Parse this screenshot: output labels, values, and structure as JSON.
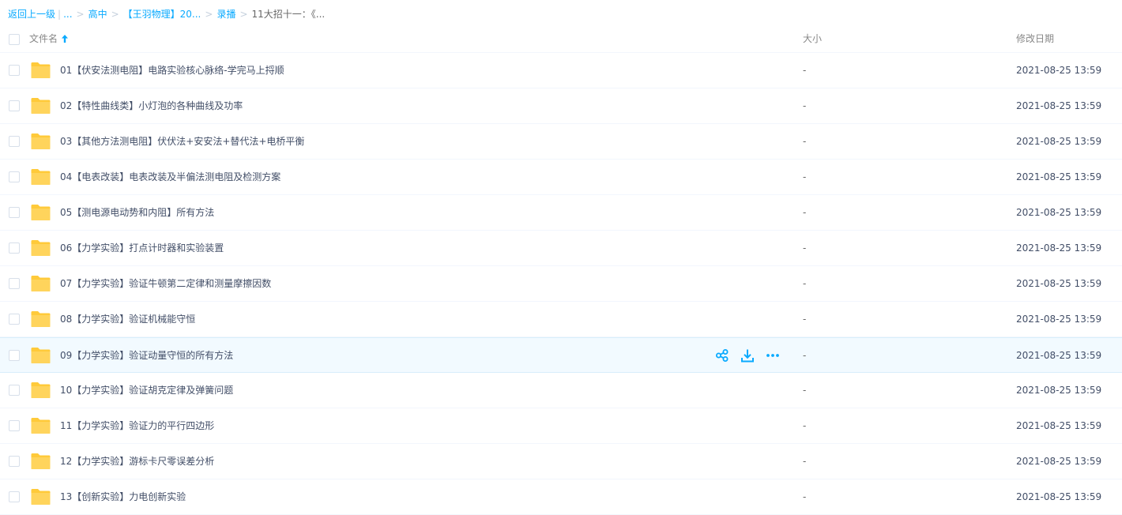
{
  "breadcrumb": {
    "back": "返回上一级",
    "bar": "|",
    "ellipsis": "...",
    "sep": ">",
    "items": [
      "高中",
      "【王羽物理】20...",
      "录播"
    ],
    "current": "11大招十一：《..."
  },
  "header": {
    "name": "文件名",
    "size": "大小",
    "date": "修改日期"
  },
  "colors": {
    "accent": "#09aaff",
    "folder": "#ffd45c",
    "hover_bg": "#f2faff"
  },
  "rows": [
    {
      "name": "01【伏安法测电阻】电路实验核心脉络-学完马上捋顺",
      "size": "-",
      "date": "2021-08-25 13:59"
    },
    {
      "name": "02【特性曲线类】小灯泡的各种曲线及功率",
      "size": "-",
      "date": "2021-08-25 13:59"
    },
    {
      "name": "03【其他方法测电阻】伏伏法+安安法+替代法+电桥平衡",
      "size": "-",
      "date": "2021-08-25 13:59"
    },
    {
      "name": "04【电表改装】电表改装及半偏法测电阻及检测方案",
      "size": "-",
      "date": "2021-08-25 13:59"
    },
    {
      "name": "05【测电源电动势和内阻】所有方法",
      "size": "-",
      "date": "2021-08-25 13:59"
    },
    {
      "name": "06【力学实验】打点计时器和实验装置",
      "size": "-",
      "date": "2021-08-25 13:59"
    },
    {
      "name": "07【力学实验】验证牛顿第二定律和测量摩擦因数",
      "size": "-",
      "date": "2021-08-25 13:59"
    },
    {
      "name": "08【力学实验】验证机械能守恒",
      "size": "-",
      "date": "2021-08-25 13:59"
    },
    {
      "name": "09【力学实验】验证动量守恒的所有方法",
      "size": "-",
      "date": "2021-08-25 13:59"
    },
    {
      "name": "10【力学实验】验证胡克定律及弹簧问题",
      "size": "-",
      "date": "2021-08-25 13:59"
    },
    {
      "name": "11【力学实验】验证力的平行四边形",
      "size": "-",
      "date": "2021-08-25 13:59"
    },
    {
      "name": "12【力学实验】游标卡尺零误差分析",
      "size": "-",
      "date": "2021-08-25 13:59"
    },
    {
      "name": "13【创新实验】力电创新实验",
      "size": "-",
      "date": "2021-08-25 13:59"
    }
  ],
  "hover_row_index": 8,
  "row_actions": [
    "share-icon",
    "download-icon",
    "more-icon"
  ]
}
